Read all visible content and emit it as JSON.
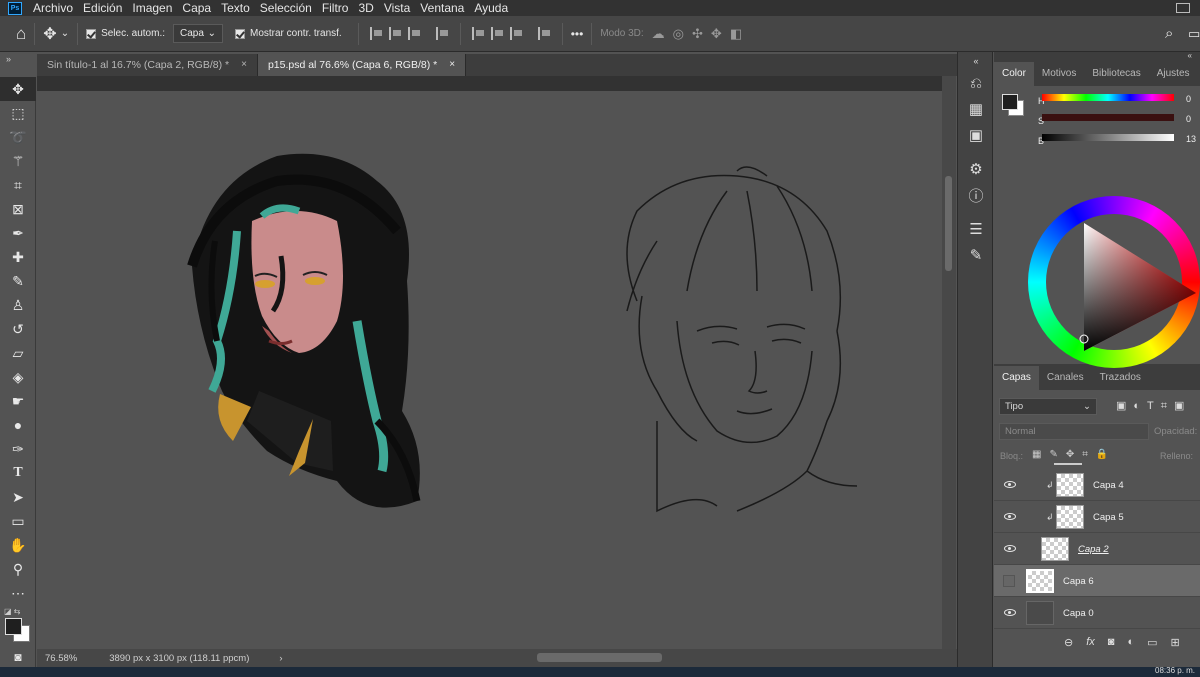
{
  "menu": {
    "app_logo": "Ps",
    "items": [
      "Archivo",
      "Edición",
      "Imagen",
      "Capa",
      "Texto",
      "Selección",
      "Filtro",
      "3D",
      "Vista",
      "Ventana",
      "Ayuda"
    ]
  },
  "options": {
    "auto_select_label": "Selec. autom.:",
    "auto_select_target": "Capa",
    "show_transform_label": "Mostrar contr. transf.",
    "mode3d_label": "Modo 3D:",
    "more": "•••"
  },
  "tabs": [
    {
      "label": "Sin título-1 al 16.7% (Capa 2, RGB/8) *",
      "close": "×"
    },
    {
      "label": "p15.psd al 76.6% (Capa 6, RGB/8) *",
      "close": "×"
    }
  ],
  "status": {
    "zoom": "76.58%",
    "doc_size": "3890 px x 3100 px (118.11 ppcm)",
    "arrow": "›"
  },
  "color_panel": {
    "tabs": [
      "Color",
      "Motivos",
      "Bibliotecas",
      "Ajustes"
    ],
    "h_label": "H",
    "s_label": "S",
    "b_label": "B",
    "h_value": "0",
    "s_value": "0",
    "b_value": "13",
    "foreground": "#1f1f1f",
    "background": "#ffffff"
  },
  "layers_panel": {
    "tabs": [
      "Capas",
      "Canales",
      "Trazados"
    ],
    "filter": "Tipo",
    "blend_mode": "Normal",
    "opacity_label": "Opacidad:",
    "lock_label": "Bloq.:",
    "fill_label": "Relleno:",
    "layers": [
      {
        "name": "Capa 4",
        "visible": true,
        "clipped": true,
        "selected": false
      },
      {
        "name": "Capa 5",
        "visible": true,
        "clipped": true,
        "selected": false
      },
      {
        "name": "Capa 2",
        "visible": true,
        "clipped": false,
        "selected": false
      },
      {
        "name": "Capa 6",
        "visible": false,
        "clipped": false,
        "selected": true
      },
      {
        "name": "Capa 0",
        "visible": true,
        "clipped": false,
        "selected": false
      }
    ]
  },
  "taskbar": {
    "time": "08:36 p. m."
  },
  "colors": {
    "accent": "#31a8ff",
    "teal_hair": "#3fa896",
    "gold": "#c8942e"
  }
}
